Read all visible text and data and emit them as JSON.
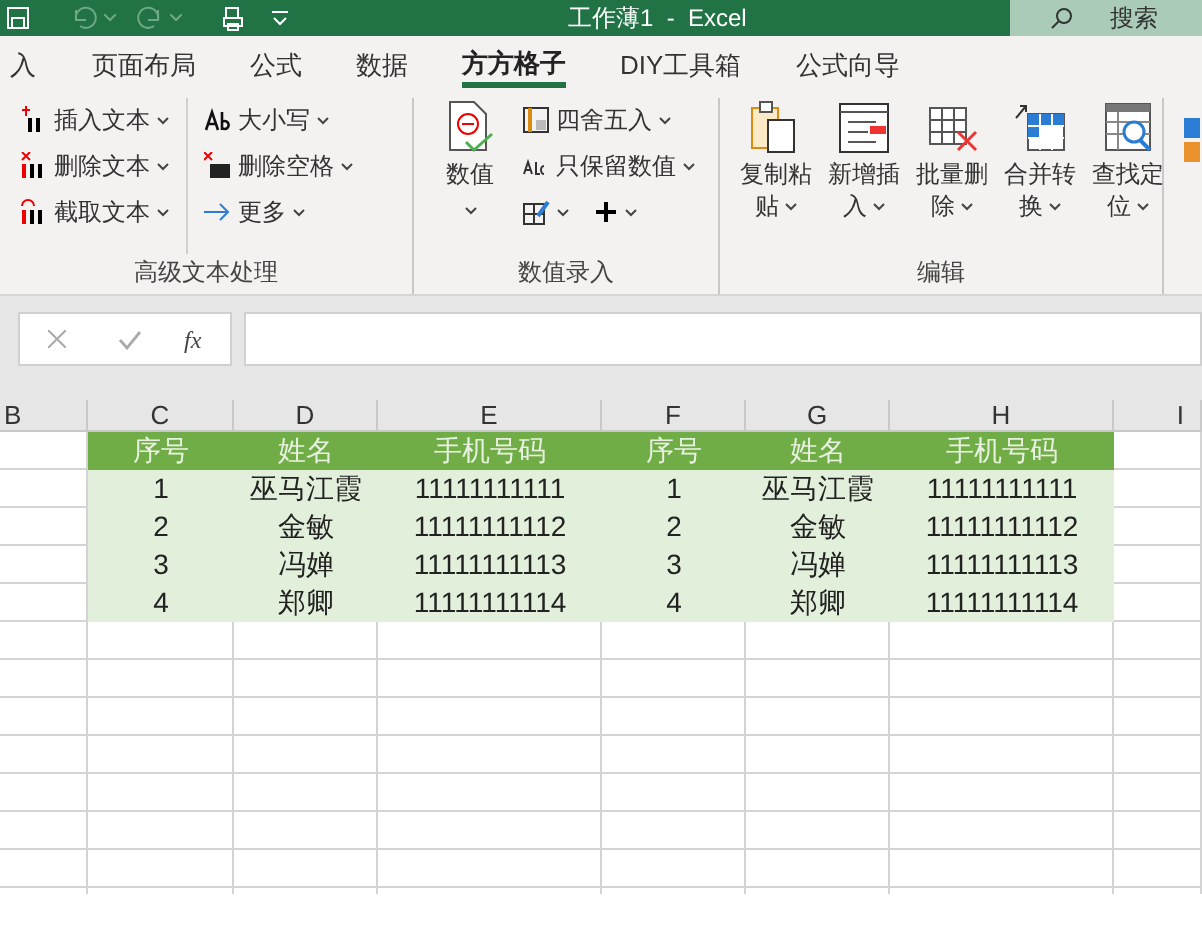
{
  "title_bar": {
    "title": "工作薄1  -  Excel",
    "search_placeholder": "搜索"
  },
  "ribbon_tabs": [
    {
      "label": "入",
      "selected": false
    },
    {
      "label": "页面布局",
      "selected": false
    },
    {
      "label": "公式",
      "selected": false
    },
    {
      "label": "数据",
      "selected": false
    },
    {
      "label": "方方格子",
      "selected": true
    },
    {
      "label": "DIY工具箱",
      "selected": false
    },
    {
      "label": "公式向导",
      "selected": false
    }
  ],
  "ribbon_groups": [
    {
      "label": "高级文本处理",
      "columns": [
        [
          {
            "label": "插入文本"
          },
          {
            "label": "删除文本"
          },
          {
            "label": "截取文本"
          }
        ],
        [
          {
            "label": "大小写"
          },
          {
            "label": "删除空格"
          },
          {
            "label": "更多"
          }
        ]
      ]
    },
    {
      "label": "数值录入",
      "large": [
        {
          "lines": [
            "数值"
          ]
        }
      ],
      "columns": [
        [
          {
            "label": "四舍五入"
          },
          {
            "label": "只保留数值"
          },
          {}
        ]
      ]
    },
    {
      "label": "编辑",
      "large": [
        {
          "lines": [
            "复制粘",
            "贴"
          ]
        },
        {
          "lines": [
            "新增插",
            "入"
          ]
        },
        {
          "lines": [
            "批量删",
            "除"
          ]
        },
        {
          "lines": [
            "合并转",
            "换"
          ]
        },
        {
          "lines": [
            "查找定",
            "位"
          ]
        }
      ]
    }
  ],
  "formula_bar": {
    "fx": "fx"
  },
  "sheet": {
    "columns": [
      "B",
      "C",
      "D",
      "E",
      "F",
      "G",
      "H",
      "I"
    ],
    "rows": [
      {
        "kind": "header",
        "cells": [
          "",
          "序号",
          "姓名",
          "手机号码",
          "序号",
          "姓名",
          "手机号码",
          ""
        ]
      },
      {
        "kind": "data",
        "cells": [
          "",
          "1",
          "巫马江霞",
          "11111111111",
          "1",
          "巫马江霞",
          "11111111111",
          ""
        ]
      },
      {
        "kind": "data",
        "cells": [
          "",
          "2",
          "金敏",
          "11111111112",
          "2",
          "金敏",
          "11111111112",
          ""
        ]
      },
      {
        "kind": "data",
        "cells": [
          "",
          "3",
          "冯婵",
          "11111111113",
          "3",
          "冯婵",
          "11111111113",
          ""
        ]
      },
      {
        "kind": "data",
        "cells": [
          "",
          "4",
          "郑卿",
          "11111111114",
          "4",
          "郑卿",
          "11111111114",
          ""
        ]
      }
    ]
  }
}
